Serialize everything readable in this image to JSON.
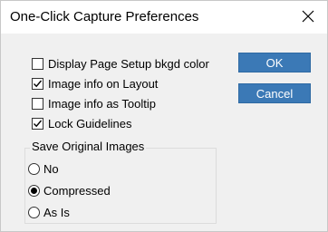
{
  "dialog": {
    "title": "One-Click Capture Preferences",
    "close_icon": "close-icon"
  },
  "options": [
    {
      "label": "Display Page Setup bkgd color",
      "checked": false
    },
    {
      "label": "Image info on Layout",
      "checked": true
    },
    {
      "label": "Image info as Tooltip",
      "checked": false
    },
    {
      "label": "Lock Guidelines",
      "checked": true
    }
  ],
  "buttons": {
    "ok": "OK",
    "cancel": "Cancel",
    "accent": "#3b79b6"
  },
  "save_original": {
    "group_label": "Save Original Images",
    "options": [
      {
        "label": "No",
        "selected": false
      },
      {
        "label": "Compressed",
        "selected": true
      },
      {
        "label": "As Is",
        "selected": false
      }
    ]
  }
}
